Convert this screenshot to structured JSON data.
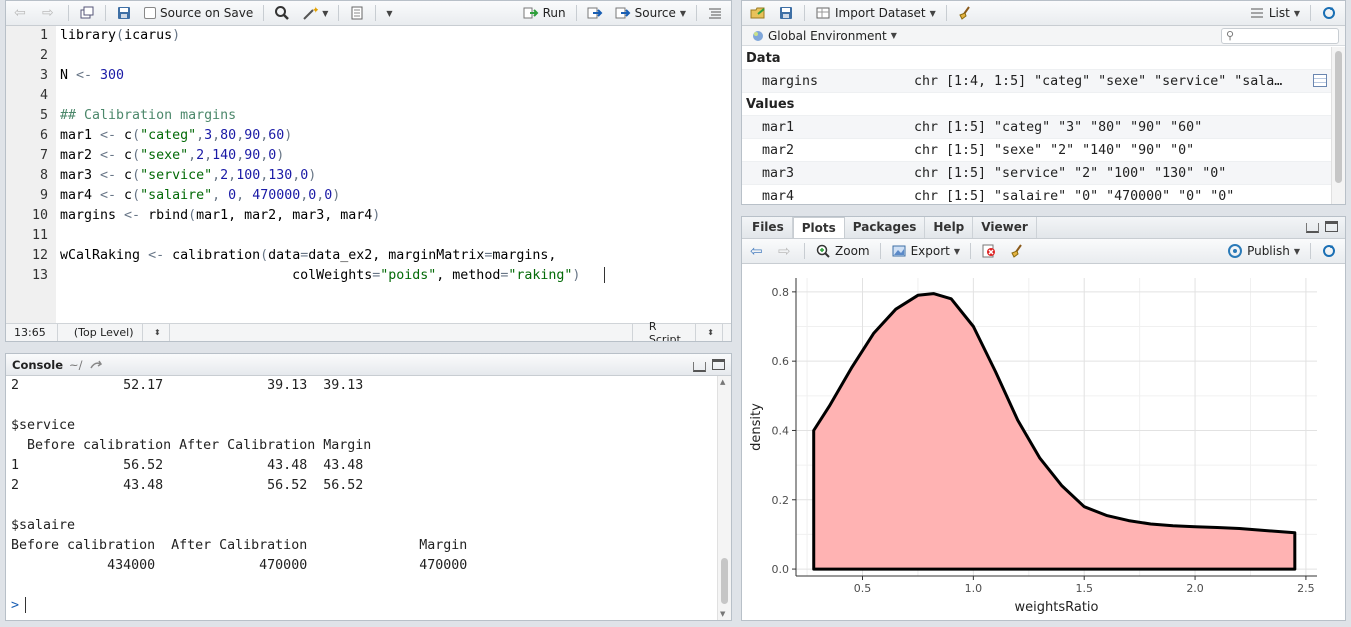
{
  "editor": {
    "toolbar": {
      "source_on_save": "Source on Save",
      "run": "Run",
      "source": "Source"
    },
    "lines": [
      {
        "n": "1",
        "tokens": [
          [
            "kw",
            "library"
          ],
          [
            "op",
            "("
          ],
          [
            "kw",
            "icarus"
          ],
          [
            "op",
            ")"
          ]
        ]
      },
      {
        "n": "2",
        "tokens": []
      },
      {
        "n": "3",
        "tokens": [
          [
            "kw",
            "N "
          ],
          [
            "op",
            "<-"
          ],
          [
            "kw",
            " "
          ],
          [
            "num",
            "300"
          ]
        ]
      },
      {
        "n": "4",
        "tokens": []
      },
      {
        "n": "5",
        "tokens": [
          [
            "cmt",
            "## Calibration margins"
          ]
        ]
      },
      {
        "n": "6",
        "tokens": [
          [
            "kw",
            "mar1 "
          ],
          [
            "op",
            "<-"
          ],
          [
            "kw",
            " c"
          ],
          [
            "op",
            "("
          ],
          [
            "str",
            "\"categ\""
          ],
          [
            "op",
            ","
          ],
          [
            "num",
            "3"
          ],
          [
            "op",
            ","
          ],
          [
            "num",
            "80"
          ],
          [
            "op",
            ","
          ],
          [
            "num",
            "90"
          ],
          [
            "op",
            ","
          ],
          [
            "num",
            "60"
          ],
          [
            "op",
            ")"
          ]
        ]
      },
      {
        "n": "7",
        "tokens": [
          [
            "kw",
            "mar2 "
          ],
          [
            "op",
            "<-"
          ],
          [
            "kw",
            " c"
          ],
          [
            "op",
            "("
          ],
          [
            "str",
            "\"sexe\""
          ],
          [
            "op",
            ","
          ],
          [
            "num",
            "2"
          ],
          [
            "op",
            ","
          ],
          [
            "num",
            "140"
          ],
          [
            "op",
            ","
          ],
          [
            "num",
            "90"
          ],
          [
            "op",
            ","
          ],
          [
            "num",
            "0"
          ],
          [
            "op",
            ")"
          ]
        ]
      },
      {
        "n": "8",
        "tokens": [
          [
            "kw",
            "mar3 "
          ],
          [
            "op",
            "<-"
          ],
          [
            "kw",
            " c"
          ],
          [
            "op",
            "("
          ],
          [
            "str",
            "\"service\""
          ],
          [
            "op",
            ","
          ],
          [
            "num",
            "2"
          ],
          [
            "op",
            ","
          ],
          [
            "num",
            "100"
          ],
          [
            "op",
            ","
          ],
          [
            "num",
            "130"
          ],
          [
            "op",
            ","
          ],
          [
            "num",
            "0"
          ],
          [
            "op",
            ")"
          ]
        ]
      },
      {
        "n": "9",
        "tokens": [
          [
            "kw",
            "mar4 "
          ],
          [
            "op",
            "<-"
          ],
          [
            "kw",
            " c"
          ],
          [
            "op",
            "("
          ],
          [
            "str",
            "\"salaire\""
          ],
          [
            "op",
            ", "
          ],
          [
            "num",
            "0"
          ],
          [
            "op",
            ", "
          ],
          [
            "num",
            "470000"
          ],
          [
            "op",
            ","
          ],
          [
            "num",
            "0"
          ],
          [
            "op",
            ","
          ],
          [
            "num",
            "0"
          ],
          [
            "op",
            ")"
          ]
        ]
      },
      {
        "n": "10",
        "tokens": [
          [
            "kw",
            "margins "
          ],
          [
            "op",
            "<-"
          ],
          [
            "kw",
            " rbind"
          ],
          [
            "op",
            "("
          ],
          [
            "kw",
            "mar1, mar2, mar3, mar4"
          ],
          [
            "op",
            ")"
          ]
        ]
      },
      {
        "n": "11",
        "tokens": []
      },
      {
        "n": "12",
        "tokens": [
          [
            "kw",
            "wCalRaking "
          ],
          [
            "op",
            "<-"
          ],
          [
            "kw",
            " calibration"
          ],
          [
            "op",
            "("
          ],
          [
            "kw",
            "data"
          ],
          [
            "op",
            "="
          ],
          [
            "kw",
            "data_ex2, marginMatrix"
          ],
          [
            "op",
            "="
          ],
          [
            "kw",
            "margins,"
          ]
        ]
      },
      {
        "n": "13",
        "tokens": [
          [
            "kw",
            "                             colWeights"
          ],
          [
            "op",
            "="
          ],
          [
            "str",
            "\"poids\""
          ],
          [
            "kw",
            ", method"
          ],
          [
            "op",
            "="
          ],
          [
            "str",
            "\"raking\""
          ],
          [
            "op",
            ")"
          ]
        ]
      }
    ],
    "status": {
      "position": "13:65",
      "scope": "(Top Level)",
      "filetype": "R Script"
    }
  },
  "console": {
    "title": "Console",
    "path": "~/",
    "lines": [
      "2             52.17             39.13  39.13",
      "",
      "$service",
      "  Before calibration After Calibration Margin",
      "1             56.52             43.48  43.48",
      "2             43.48             56.52  56.52",
      "",
      "$salaire",
      "Before calibration  After Calibration              Margin",
      "            434000             470000              470000"
    ],
    "prompt": ">"
  },
  "environment": {
    "toolbar": {
      "import_dataset": "Import Dataset",
      "view_mode": "List",
      "scope": "Global Environment"
    },
    "search_placeholder": "",
    "sections": [
      {
        "title": "Data",
        "rows": [
          {
            "name": "margins",
            "value": "chr [1:4, 1:5] \"categ\" \"sexe\" \"service\" \"sala…"
          }
        ]
      },
      {
        "title": "Values",
        "rows": [
          {
            "name": "mar1",
            "value": "chr [1:5] \"categ\" \"3\" \"80\" \"90\" \"60\""
          },
          {
            "name": "mar2",
            "value": "chr [1:5] \"sexe\" \"2\" \"140\" \"90\" \"0\""
          },
          {
            "name": "mar3",
            "value": "chr [1:5] \"service\" \"2\" \"100\" \"130\" \"0\""
          },
          {
            "name": "mar4",
            "value": "chr [1:5] \"salaire\" \"0\" \"470000\" \"0\" \"0\""
          }
        ]
      }
    ]
  },
  "viewer": {
    "tabs": [
      "Files",
      "Plots",
      "Packages",
      "Help",
      "Viewer"
    ],
    "active_tab": "Plots",
    "toolbar": {
      "zoom": "Zoom",
      "export": "Export",
      "publish": "Publish"
    }
  },
  "chart_data": {
    "type": "area",
    "title": "",
    "xlabel": "weightsRatio",
    "ylabel": "density",
    "xlim": [
      0.2,
      2.55
    ],
    "ylim": [
      -0.02,
      0.84
    ],
    "xticks": [
      "0.5",
      "1.0",
      "1.5",
      "2.0",
      "2.5"
    ],
    "yticks": [
      "0.0",
      "0.2",
      "0.4",
      "0.6",
      "0.8"
    ],
    "grid": true,
    "fill_color": "#ffb3b3",
    "line_color": "#000000",
    "series": [
      {
        "x": [
          0.28,
          0.35,
          0.45,
          0.55,
          0.65,
          0.75,
          0.82,
          0.9,
          1.0,
          1.1,
          1.2,
          1.3,
          1.4,
          1.5,
          1.6,
          1.7,
          1.8,
          1.9,
          2.0,
          2.1,
          2.2,
          2.3,
          2.45
        ],
        "y": [
          0.4,
          0.47,
          0.58,
          0.68,
          0.75,
          0.79,
          0.795,
          0.78,
          0.7,
          0.57,
          0.43,
          0.32,
          0.24,
          0.18,
          0.155,
          0.14,
          0.13,
          0.125,
          0.122,
          0.12,
          0.117,
          0.112,
          0.105
        ]
      }
    ]
  }
}
